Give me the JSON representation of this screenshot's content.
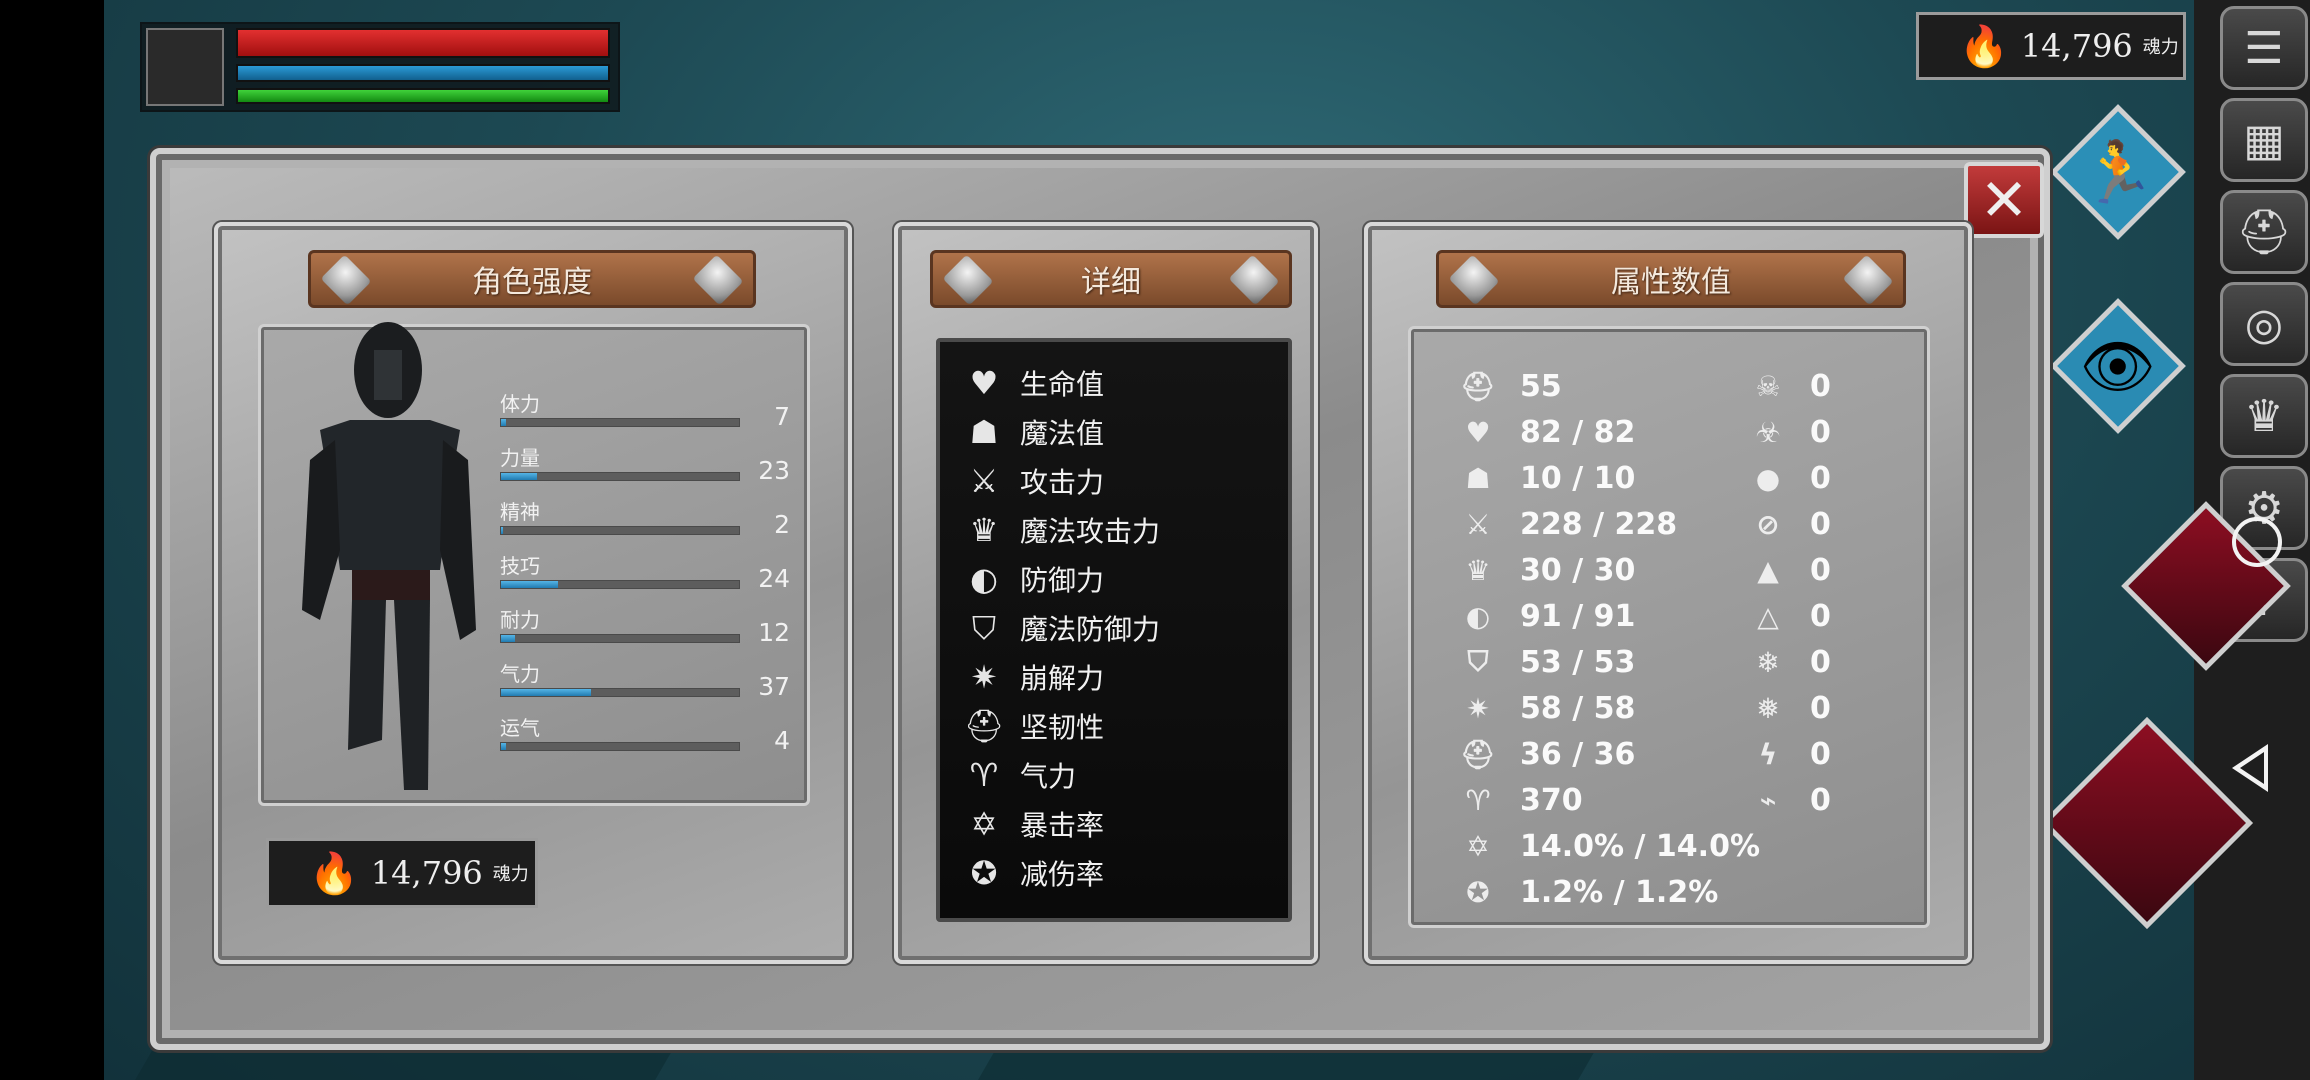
{
  "hud": {
    "soul_icon": "flame-icon",
    "soul_value": "14,796",
    "soul_unit": "魂力"
  },
  "side_buttons": [
    "menu-icon",
    "map-icon",
    "helmet-icon",
    "camera-icon",
    "crown-icon",
    "gear-icon",
    "help-icon"
  ],
  "panels": {
    "character": {
      "title": "角色强度",
      "stats": [
        {
          "label": "体力",
          "value": "7",
          "fill": 0.02
        },
        {
          "label": "力量",
          "value": "23",
          "fill": 0.15
        },
        {
          "label": "精神",
          "value": "2",
          "fill": 0.01
        },
        {
          "label": "技巧",
          "value": "24",
          "fill": 0.24
        },
        {
          "label": "耐力",
          "value": "12",
          "fill": 0.06
        },
        {
          "label": "气力",
          "value": "37",
          "fill": 0.38
        },
        {
          "label": "运气",
          "value": "4",
          "fill": 0.02
        }
      ],
      "soul_value": "14,796",
      "soul_unit": "魂力"
    },
    "details": {
      "title": "详细",
      "items": [
        {
          "icon": "heart-icon",
          "label": "生命值"
        },
        {
          "icon": "mind-icon",
          "label": "魔法值"
        },
        {
          "icon": "sword-icon",
          "label": "攻击力"
        },
        {
          "icon": "magic-crown-icon",
          "label": "魔法攻击力"
        },
        {
          "icon": "shield-icon",
          "label": "防御力"
        },
        {
          "icon": "magic-shield-icon",
          "label": "魔法防御力"
        },
        {
          "icon": "break-icon",
          "label": "崩解力"
        },
        {
          "icon": "helmet-icon",
          "label": "坚韧性"
        },
        {
          "icon": "lungs-icon",
          "label": "气力"
        },
        {
          "icon": "critical-star-icon",
          "label": "暴击率"
        },
        {
          "icon": "damage-reduction-icon",
          "label": "减伤率"
        }
      ]
    },
    "attributes": {
      "title": "属性数值",
      "left": [
        {
          "icon": "level-helmet-icon",
          "value": "55"
        },
        {
          "icon": "heart-icon",
          "value": "82 / 82"
        },
        {
          "icon": "mind-icon",
          "value": "10 / 10"
        },
        {
          "icon": "sword-icon",
          "value": "228 / 228"
        },
        {
          "icon": "magic-crown-icon",
          "value": "30 / 30"
        },
        {
          "icon": "shield-icon",
          "value": "91 / 91"
        },
        {
          "icon": "magic-shield-icon",
          "value": "53 / 53"
        },
        {
          "icon": "break-icon",
          "value": "58 / 58"
        },
        {
          "icon": "helmet-icon",
          "value": "36 / 36"
        },
        {
          "icon": "lungs-icon",
          "value": "370"
        },
        {
          "icon": "critical-star-icon",
          "value": "14.0% / 14.0%"
        },
        {
          "icon": "damage-reduction-icon",
          "value": "1.2% / 1.2%"
        }
      ],
      "right": [
        {
          "icon": "skull-icon",
          "value": "0"
        },
        {
          "icon": "poison-skull-icon",
          "value": "0"
        },
        {
          "icon": "blood-drop-icon",
          "value": "0"
        },
        {
          "icon": "no-bleed-icon",
          "value": "0"
        },
        {
          "icon": "fire-icon",
          "value": "0"
        },
        {
          "icon": "no-fire-icon",
          "value": "0"
        },
        {
          "icon": "frost-icon",
          "value": "0"
        },
        {
          "icon": "no-frost-icon",
          "value": "0"
        },
        {
          "icon": "lightning-icon",
          "value": "0"
        },
        {
          "icon": "no-lightning-icon",
          "value": "0"
        }
      ]
    }
  }
}
